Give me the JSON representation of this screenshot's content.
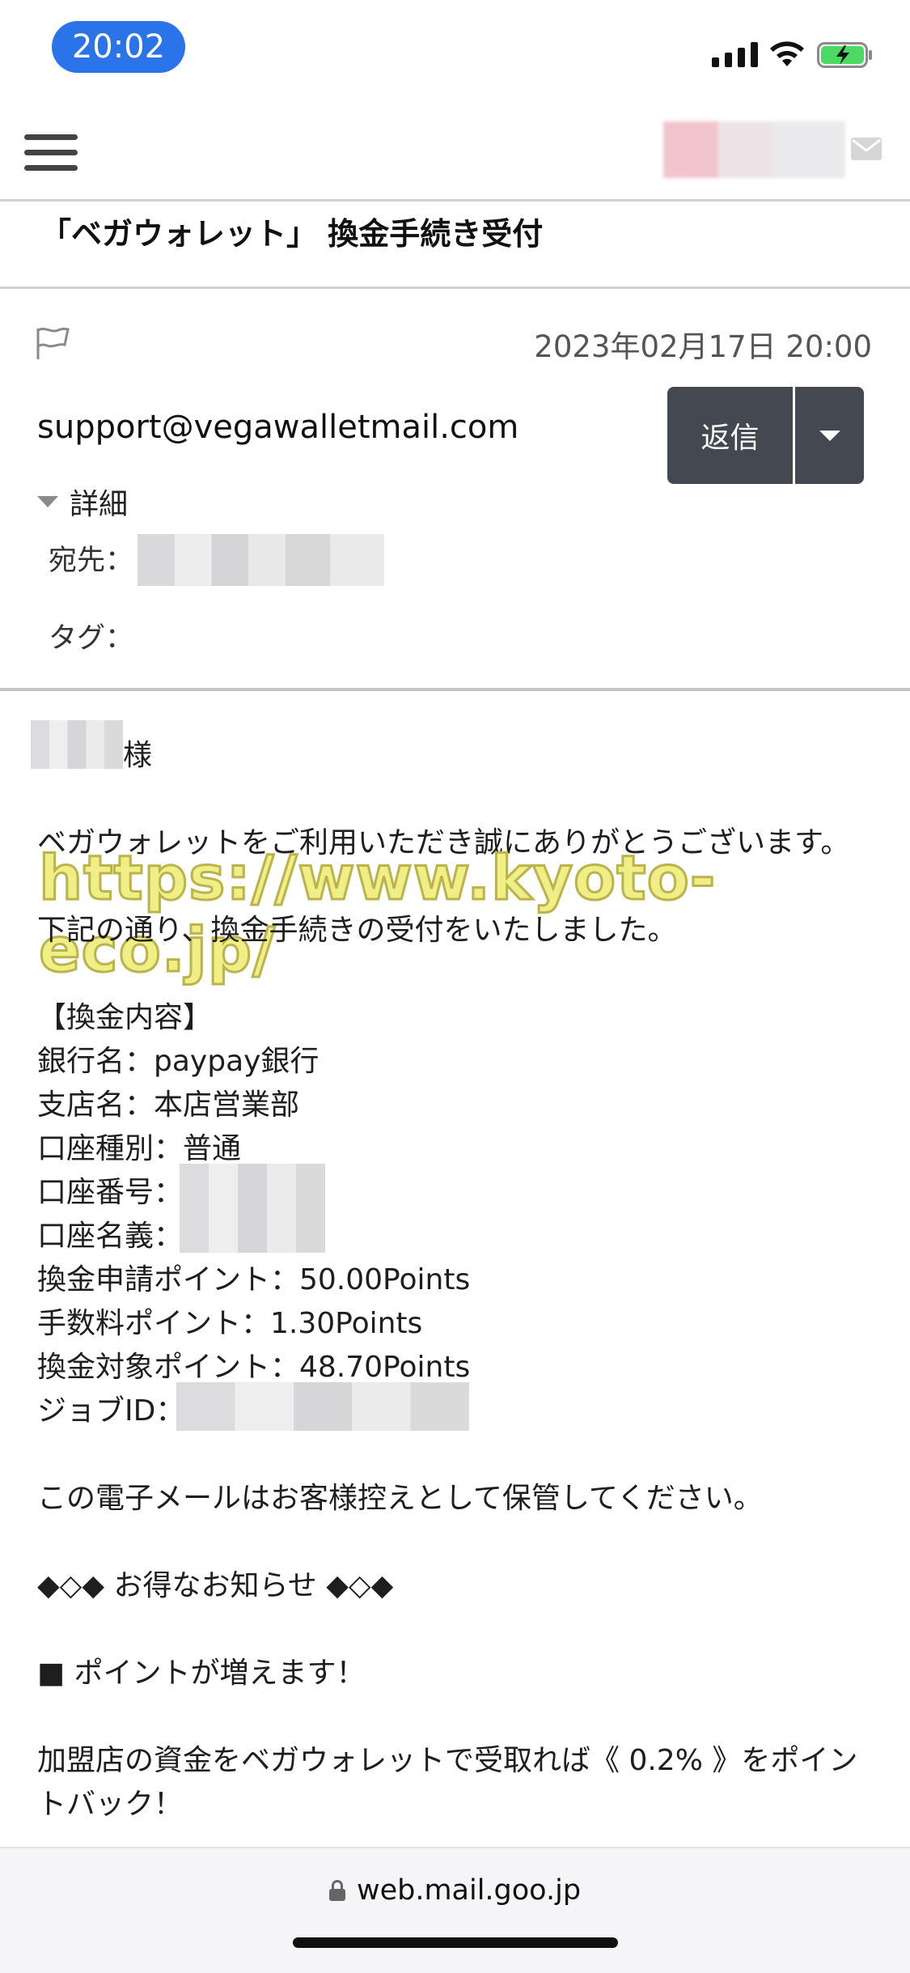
{
  "status_bar": {
    "time": "20:02"
  },
  "header": {
    "subject": "「ベガウォレット」 換金手続き受付"
  },
  "message": {
    "date": "2023年02月17日 20:00",
    "sender": "support@vegawalletmail.com",
    "reply_label": "返信",
    "details_label": "詳細",
    "to_label": "宛先：",
    "tag_label": "タグ："
  },
  "body": {
    "salutation_suffix": "様",
    "line1": "ベガウォレットをご利用いただき誠にありがとうございます。",
    "line2": "下記の通り、換金手続きの受付をいたしました。",
    "section_title": "【換金内容】",
    "bank": "銀行名：paypay銀行",
    "branch": "支店名：本店営業部",
    "account_type": "口座種別：普通",
    "account_number_label": "口座番号：",
    "account_name_label": "口座名義：",
    "request_points": "換金申請ポイント：50.00Points",
    "fee_points": "手数料ポイント：1.30Points",
    "target_points": "換金対象ポイント：48.70Points",
    "job_id_label": "ジョブID：",
    "keep_notice": "この電子メールはお客様控えとして保管してください。",
    "promo_header": "◆◇◆ お得なお知らせ ◆◇◆",
    "promo_item": "■ ポイントが増えます！",
    "promo_line1": "加盟店の資金をベガウォレットで受取れば《 0.2% 》をポイン",
    "promo_line2": "トバック！"
  },
  "watermark": "https://www.kyoto-eco.jp/",
  "browser": {
    "url": "web.mail.goo.jp"
  },
  "colors": {
    "accent": "#2a73e8",
    "reply_button": "#444850",
    "battery": "#4cd964"
  }
}
